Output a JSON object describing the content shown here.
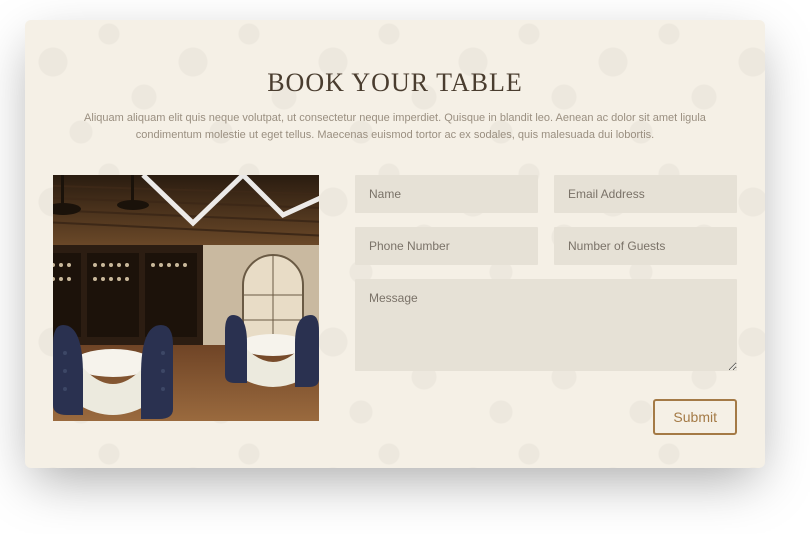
{
  "heading": "BOOK YOUR TABLE",
  "subtitle": "Aliquam aliquam elit quis neque volutpat, ut consectetur neque imperdiet. Quisque in blandit leo. Aenean ac dolor sit amet ligula condimentum molestie ut eget tellus. Maecenas euismod tortor ac ex sodales, quis malesuada dui lobortis.",
  "form": {
    "name_placeholder": "Name",
    "email_placeholder": "Email Address",
    "phone_placeholder": "Phone Number",
    "guests_placeholder": "Number of Guests",
    "message_placeholder": "Message",
    "submit_label": "Submit"
  },
  "image_alt": "Restaurant interior with navy velvet chairs, white-cloth round tables, wooden ceiling beams, chandeliers, and a wine shelf wall"
}
